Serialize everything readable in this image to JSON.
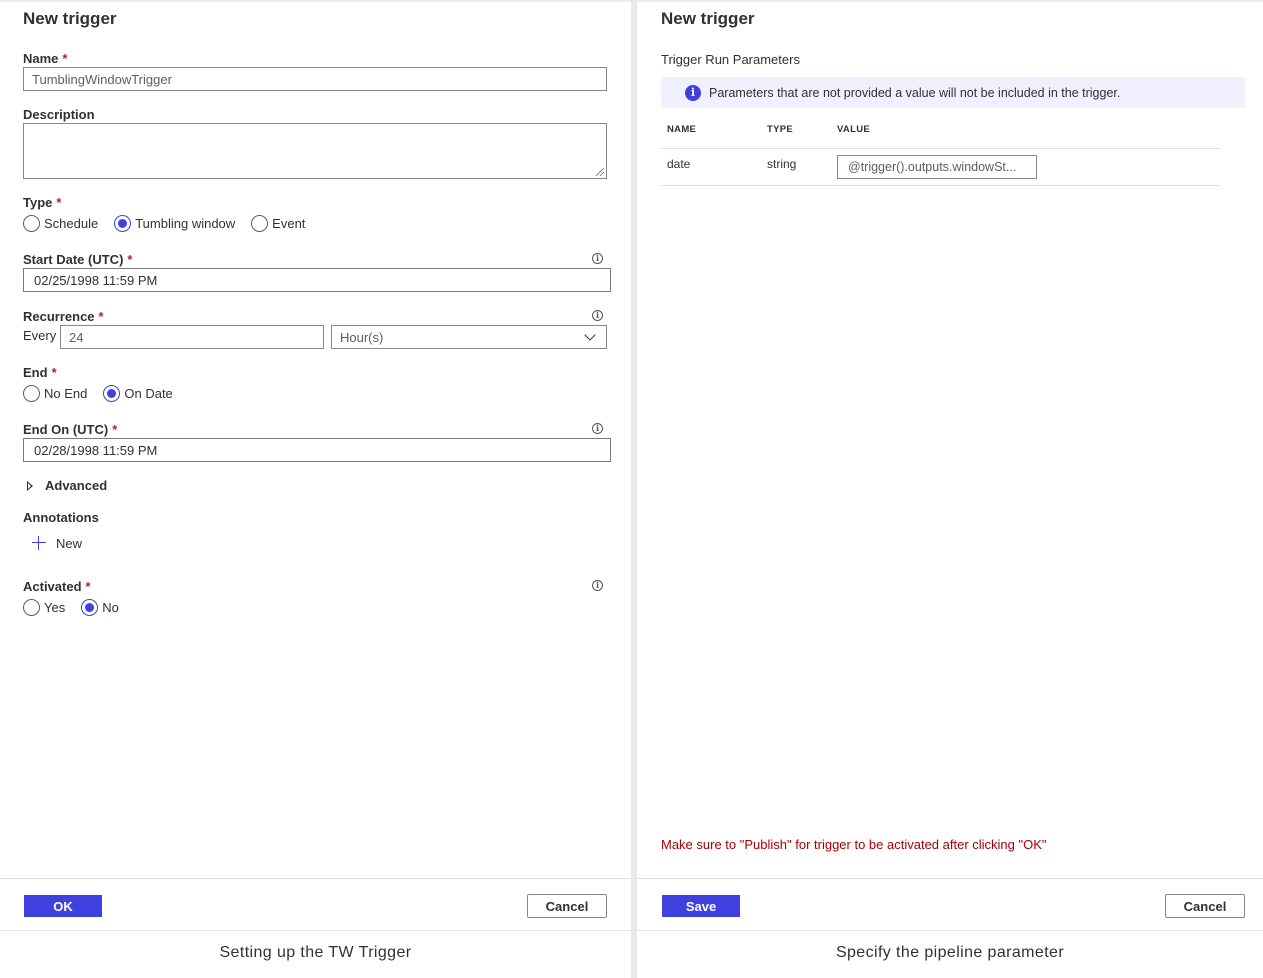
{
  "left": {
    "title": "New trigger",
    "name": {
      "label": "Name",
      "required": "*",
      "value": "TumblingWindowTrigger"
    },
    "description": {
      "label": "Description",
      "value": ""
    },
    "type": {
      "label": "Type",
      "required": "*",
      "options": [
        "Schedule",
        "Tumbling window",
        "Event"
      ],
      "selected": "Tumbling window"
    },
    "start_date": {
      "label": "Start Date (UTC)",
      "required": "*",
      "value": "02/25/1998 11:59 PM"
    },
    "recurrence": {
      "label": "Recurrence",
      "required": "*",
      "every_label": "Every",
      "interval": "24",
      "unit": "Hour(s)"
    },
    "end": {
      "label": "End",
      "required": "*",
      "options": [
        "No End",
        "On Date"
      ],
      "selected": "On Date"
    },
    "end_on": {
      "label": "End On (UTC)",
      "required": "*",
      "value": "02/28/1998 11:59 PM"
    },
    "advanced_label": "Advanced",
    "annotations": {
      "label": "Annotations",
      "new_label": "New"
    },
    "activated": {
      "label": "Activated",
      "required": "*",
      "options": [
        "Yes",
        "No"
      ],
      "selected": "No"
    },
    "ok_label": "OK",
    "cancel_label": "Cancel",
    "caption": "Setting up the TW Trigger"
  },
  "right": {
    "title": "New trigger",
    "subtitle": "Trigger Run Parameters",
    "info_text": "Parameters that are not provided a value will not be included in the trigger.",
    "columns": [
      "NAME",
      "TYPE",
      "VALUE"
    ],
    "rows": [
      {
        "name": "date",
        "type": "string",
        "value": "@trigger().outputs.windowSt..."
      }
    ],
    "warning": "Make sure to \"Publish\" for trigger to be activated after clicking \"OK\"",
    "save_label": "Save",
    "cancel_label": "Cancel",
    "caption": "Specify the pipeline parameter"
  },
  "colors": {
    "accent": "#4040df",
    "required": "#a4262c",
    "warning": "#a80000",
    "info_bg": "#f0f0ff"
  }
}
